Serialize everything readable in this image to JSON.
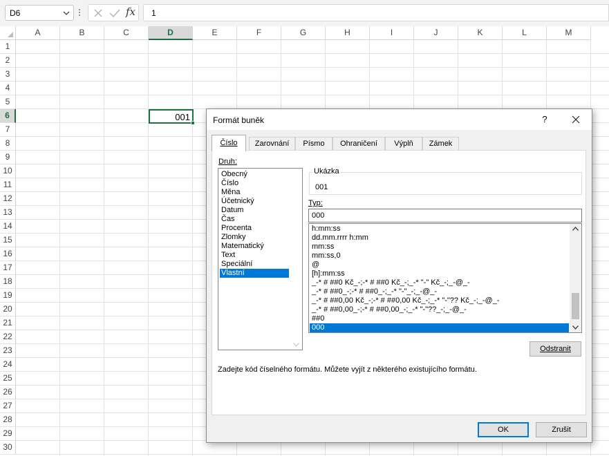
{
  "formula_bar": {
    "name_box": "D6",
    "formula": "1"
  },
  "sheet": {
    "columns": [
      "A",
      "B",
      "C",
      "D",
      "E",
      "F",
      "G",
      "H",
      "I",
      "J",
      "K",
      "L",
      "M"
    ],
    "rows": [
      "1",
      "2",
      "3",
      "4",
      "5",
      "6",
      "7",
      "8",
      "9",
      "10",
      "11",
      "12",
      "13",
      "14",
      "15",
      "16",
      "17",
      "18",
      "19",
      "20",
      "21",
      "22",
      "23",
      "24",
      "25",
      "26",
      "27",
      "28",
      "29",
      "30"
    ],
    "active_column": "D",
    "active_row": "6",
    "active_cell_display": "001"
  },
  "dialog": {
    "title": "Formát buněk",
    "help": "?",
    "tabs": [
      "Číslo",
      "Zarovnání",
      "Písmo",
      "Ohraničení",
      "Výplň",
      "Zámek"
    ],
    "active_tab": "Číslo",
    "druh_label": "Druh:",
    "druh_items": [
      "Obecný",
      "Číslo",
      "Měna",
      "Účetnický",
      "Datum",
      "Čas",
      "Procenta",
      "Zlomky",
      "Matematický",
      "Text",
      "Speciální",
      "Vlastní"
    ],
    "druh_selected": "Vlastní",
    "ukazka_label": "Ukázka",
    "ukazka_value": "001",
    "typ_label": "Typ:",
    "typ_value": "000",
    "format_items": [
      "h:mm:ss",
      "dd.mm.rrrr h:mm",
      "mm:ss",
      "mm:ss,0",
      "@",
      "[h]:mm:ss",
      "_-* # ##0 Kč_-;-* # ##0 Kč_-;_-* \"-\" Kč_-;_-@_-",
      "_-* # ##0_-;-* # ##0_-;_-* \"-\"_-;_-@_-",
      "_-* # ##0,00 Kč_-;-* # ##0,00 Kč_-;_-* \"-\"?? Kč_-;_-@_-",
      "_-* # ##0,00_-;-* # ##0,00_-;_-* \"-\"??_-;_-@_-",
      "##0",
      "000"
    ],
    "format_selected": "000",
    "delete_button": "Odstranit",
    "hint": "Zadejte kód číselného formátu. Můžete vyjít z některého existujícího formátu.",
    "ok_button": "OK",
    "cancel_button": "Zrušit"
  },
  "colors": {
    "accent": "#0078d7",
    "excel_green": "#1f7145",
    "dialog_bg": "#f0f0f0"
  }
}
